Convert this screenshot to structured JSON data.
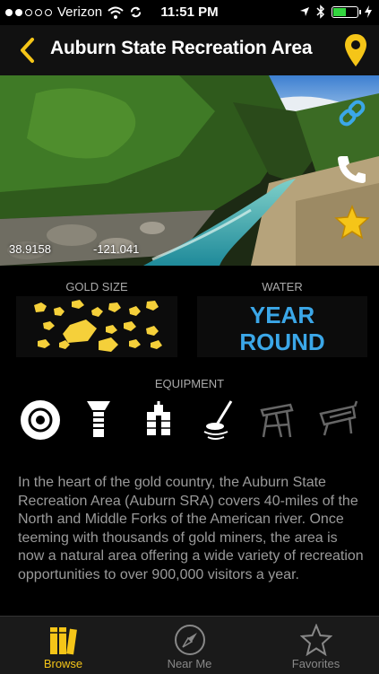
{
  "status": {
    "carrier": "Verizon",
    "time": "11:51 PM",
    "signal_filled": 2,
    "signal_total": 5,
    "battery_level": 0.55
  },
  "nav": {
    "title": "Auburn State Recreation Area",
    "back_icon": "chevron-left-icon",
    "map_icon": "map-pin-icon"
  },
  "hero": {
    "latitude": "38.9158",
    "longitude": "-121.041",
    "actions": [
      "link-icon",
      "phone-icon",
      "star-icon"
    ]
  },
  "stats": {
    "gold_label": "GOLD SIZE",
    "water_label": "WATER",
    "water_line1": "YEAR",
    "water_line2": "ROUND"
  },
  "equipment": {
    "label": "EQUIPMENT",
    "items": [
      {
        "name": "gold-pan-icon",
        "available": true
      },
      {
        "name": "sluice-icon",
        "available": true
      },
      {
        "name": "dredge-icon",
        "available": true
      },
      {
        "name": "metal-detector-icon",
        "available": true
      },
      {
        "name": "highbanker-icon",
        "available": false
      },
      {
        "name": "rocker-box-icon",
        "available": false
      }
    ]
  },
  "description": "In the heart of the gold country, the Auburn State Recreation Area (Auburn SRA) covers 40-miles of the North and Middle Forks of the American river. Once teeming with thousands of gold miners, the area is now a natural area offering a wide variety of recreation opportunities to over 900,000 visitors a year.",
  "tabs": [
    {
      "label": "Browse",
      "icon": "books-icon",
      "active": true
    },
    {
      "label": "Near Me",
      "icon": "compass-icon",
      "active": false
    },
    {
      "label": "Favorites",
      "icon": "star-outline-icon",
      "active": false
    }
  ],
  "colors": {
    "accent": "#f5c518",
    "water": "#3ba7e8",
    "battery": "#33d63f"
  }
}
